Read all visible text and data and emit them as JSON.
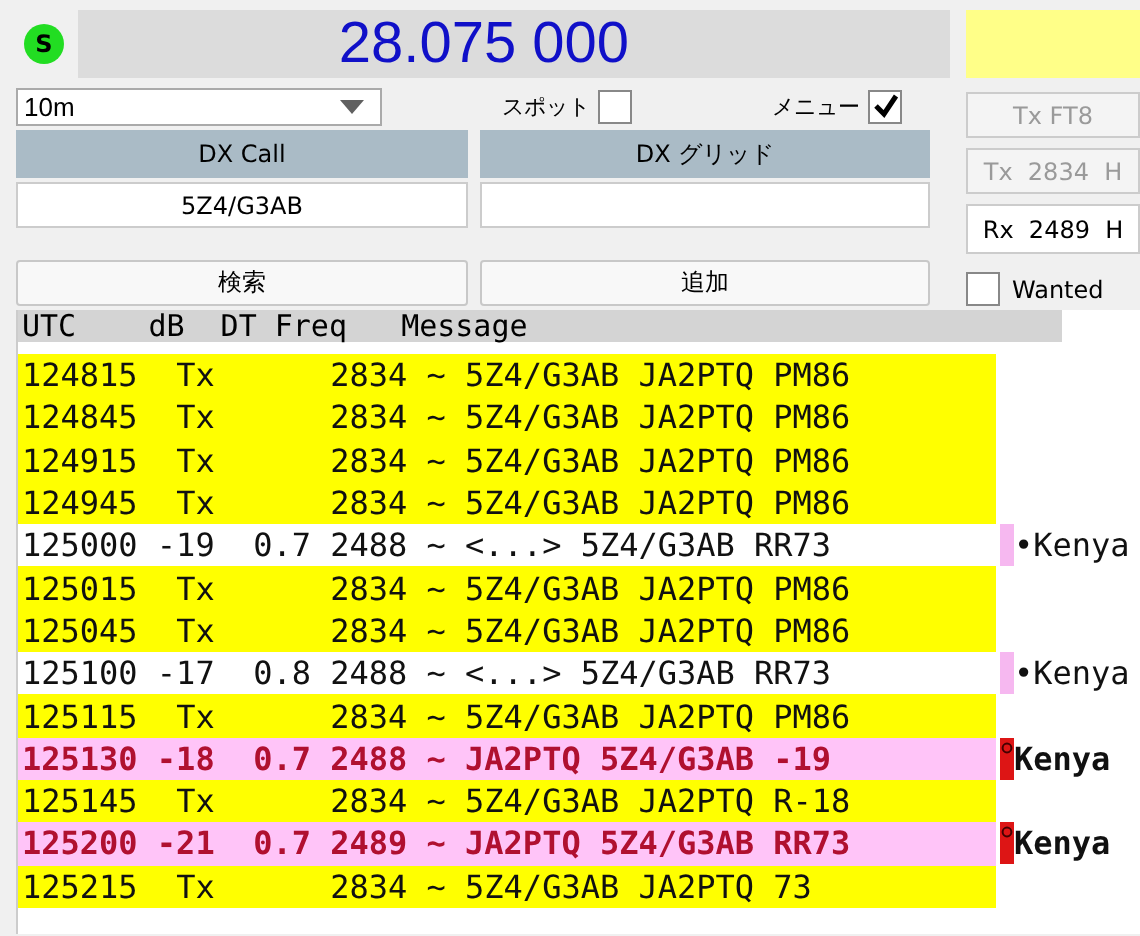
{
  "status_indicator": {
    "label": "S",
    "on": true
  },
  "frequency": "28.075 000",
  "band": "10m",
  "spot": {
    "label": "スポット",
    "checked": false
  },
  "menu": {
    "label": "メニュー",
    "checked": true
  },
  "dx_call": {
    "header": "DX Call",
    "value": "5Z4/G3AB"
  },
  "dx_grid": {
    "header": "DX グリッド"
  },
  "buttons": [
    "検索",
    "追加"
  ],
  "side": {
    "tx_mode": {
      "label": "Tx FT8",
      "disabled": true
    },
    "tx_freq": {
      "label": "Tx  2834  H",
      "disabled": true
    },
    "rx_freq": "Rx  2489  H",
    "wanted": {
      "label": "Wanted",
      "checked": false
    }
  },
  "columns": [
    "UTC",
    "dB",
    "DT",
    "Freq",
    "Message"
  ],
  "rows": [
    {
      "kind": "tx",
      "utc": "124815",
      "db": "Tx",
      "freq": "2834",
      "sep": "~",
      "message": "5Z4/G3AB JA2PTQ PM86"
    },
    {
      "kind": "tx",
      "utc": "124845",
      "db": "Tx",
      "freq": "2834",
      "sep": "~",
      "message": "5Z4/G3AB JA2PTQ PM86"
    },
    {
      "kind": "tx",
      "utc": "124915",
      "db": "Tx",
      "freq": "2834",
      "sep": "~",
      "message": "5Z4/G3AB JA2PTQ PM86"
    },
    {
      "kind": "tx",
      "utc": "124945",
      "db": "Tx",
      "freq": "2834",
      "sep": "~",
      "message": "5Z4/G3AB JA2PTQ PM86"
    },
    {
      "kind": "rx",
      "utc": "125000",
      "db": "-19",
      "dt": "0.7",
      "freq": "2488",
      "sep": "~",
      "message": "<...> 5Z4/G3AB RR73",
      "country": "•Kenya"
    },
    {
      "kind": "tx",
      "utc": "125015",
      "db": "Tx",
      "freq": "2834",
      "sep": "~",
      "message": "5Z4/G3AB JA2PTQ PM86"
    },
    {
      "kind": "tx",
      "utc": "125045",
      "db": "Tx",
      "freq": "2834",
      "sep": "~",
      "message": "5Z4/G3AB JA2PTQ PM86"
    },
    {
      "kind": "rx",
      "utc": "125100",
      "db": "-17",
      "dt": "0.8",
      "freq": "2488",
      "sep": "~",
      "message": "<...> 5Z4/G3AB RR73",
      "country": "•Kenya"
    },
    {
      "kind": "tx",
      "utc": "125115",
      "db": "Tx",
      "freq": "2834",
      "sep": "~",
      "message": "5Z4/G3AB JA2PTQ PM86"
    },
    {
      "kind": "to_me",
      "utc": "125130",
      "db": "-18",
      "dt": "0.7",
      "freq": "2488",
      "sep": "~",
      "message": "JA2PTQ 5Z4/G3AB -19",
      "country": "Kenya"
    },
    {
      "kind": "tx",
      "utc": "125145",
      "db": "Tx",
      "freq": "2834",
      "sep": "~",
      "message": "5Z4/G3AB JA2PTQ R-18"
    },
    {
      "kind": "to_me",
      "utc": "125200",
      "db": "-21",
      "dt": "0.7",
      "freq": "2489",
      "sep": "~",
      "message": "JA2PTQ 5Z4/G3AB RR73",
      "country": "Kenya"
    },
    {
      "kind": "tx",
      "utc": "125215",
      "db": "Tx",
      "freq": "2834",
      "sep": "~",
      "message": "5Z4/G3AB JA2PTQ 73"
    }
  ]
}
